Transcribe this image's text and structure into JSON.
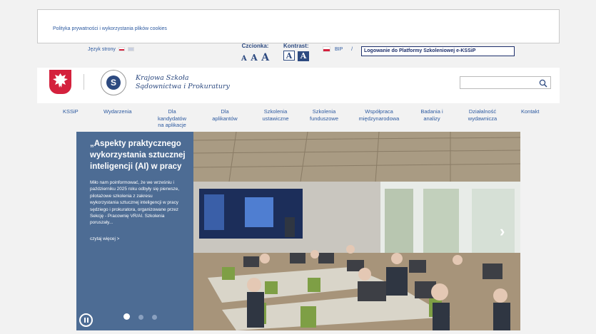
{
  "cookie": {
    "link": "Polityka prywatności i wykorzystania plików cookies"
  },
  "utility": {
    "language_label": "Język strony",
    "font_label": "Czcionka:",
    "font_sizes": [
      "A",
      "A",
      "A"
    ],
    "contrast_label": "Kontrast:",
    "contrast_options": [
      "A",
      "A"
    ],
    "bip": "BIP",
    "separator": "/",
    "login": "Logowanie do Platformy Szkoleniowej e-KSSiP"
  },
  "header": {
    "school_name_line1": "Krajowa Szkoła",
    "school_name_line2": "Sądownictwa i Prokuratury",
    "search_placeholder": ""
  },
  "nav": [
    "KSSiP",
    "Wydarzenia",
    "Dla kandydatów na aplikacje",
    "Dla aplikantów",
    "Szkolenia ustawiczne",
    "Szkolenia funduszowe",
    "Współpraca międzynarodowa",
    "Badania i analizy",
    "Działalność wydawnicza",
    "Kontakt"
  ],
  "hero": {
    "title": "„Aspekty praktycznego wykorzystania sztucznej inteligencji (AI) w pracy",
    "text": "Miło nam poinformować, że we wrześniu i październiku 2025 roku odbyły się pierwsze, pilotażowe szkolenia z zakresu wykorzystania sztucznej inteligencji w pracy sędziego i prokuratora, organizowane przez Sekcję - Pracownię VR/AI. Szkolenia poruszały...",
    "more": "czytaj więcej >"
  },
  "colors": {
    "brand": "#2d4a80",
    "hero_panel": "#4d6c94",
    "link": "#2d5aa0"
  }
}
